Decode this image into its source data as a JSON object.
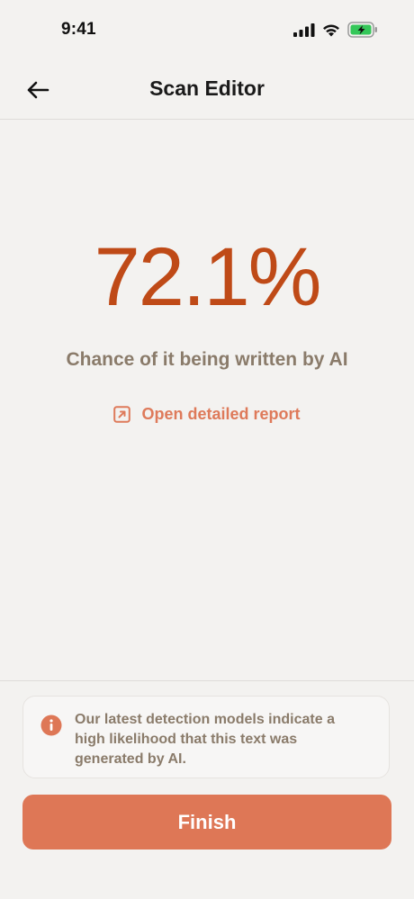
{
  "status_bar": {
    "time": "9:41"
  },
  "header": {
    "title": "Scan Editor",
    "back_icon": "arrow-left-icon"
  },
  "result": {
    "score": "72.1%",
    "caption": "Chance of it being written by AI",
    "report_link_label": "Open detailed report",
    "report_link_icon": "external-link-icon"
  },
  "info": {
    "icon": "info-icon",
    "message": "Our latest detection models indicate a high likelihood that this text was generated by AI."
  },
  "actions": {
    "finish_label": "Finish"
  },
  "colors": {
    "background": "#F3F2F0",
    "score": "#BF4A17",
    "accent": "#DE7756",
    "muted_text": "#8A7B6A",
    "battery_charging": "#34C759"
  }
}
